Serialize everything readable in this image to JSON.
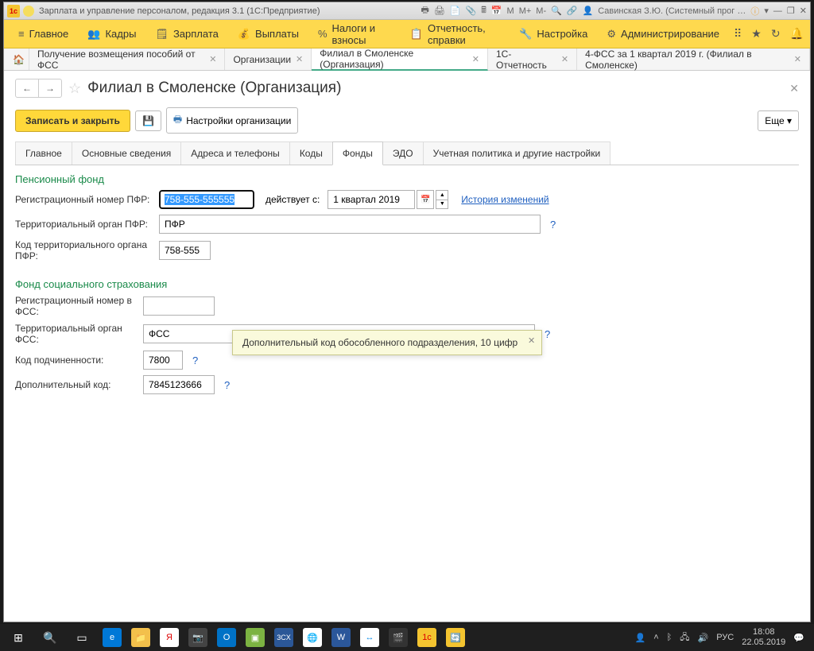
{
  "titlebar": {
    "title": "Зарплата и управление персоналом, редакция 3.1  (1С:Предприятие)",
    "user": "Савинская З.Ю. (Системный прог …",
    "m_icons": [
      "M",
      "M+",
      "M-"
    ]
  },
  "mainmenu": [
    {
      "label": "Главное"
    },
    {
      "label": "Кадры"
    },
    {
      "label": "Зарплата"
    },
    {
      "label": "Выплаты"
    },
    {
      "label": "Налоги и взносы"
    },
    {
      "label": "Отчетность, справки"
    },
    {
      "label": "Настройка"
    },
    {
      "label": "Администрирование"
    }
  ],
  "wtabs": [
    {
      "label": "Получение возмещения пособий от ФСС",
      "active": false
    },
    {
      "label": "Организации",
      "active": false
    },
    {
      "label": "Филиал в Смоленске (Организация)",
      "active": true
    },
    {
      "label": "1С-Отчетность",
      "active": false
    },
    {
      "label": "4-ФСС за 1 квартал 2019 г. (Филиал в Смоленске)",
      "active": false
    }
  ],
  "page": {
    "title": "Филиал в Смоленске (Организация)"
  },
  "toolbar": {
    "save_close": "Записать и закрыть",
    "org_settings": "Настройки организации",
    "more": "Еще"
  },
  "innertabs": [
    {
      "label": "Главное"
    },
    {
      "label": "Основные сведения"
    },
    {
      "label": "Адреса и телефоны"
    },
    {
      "label": "Коды"
    },
    {
      "label": "Фонды",
      "active": true
    },
    {
      "label": "ЭДО"
    },
    {
      "label": "Учетная политика и другие настройки"
    }
  ],
  "pfr": {
    "section": "Пенсионный фонд",
    "reg_label": "Регистрационный номер ПФР:",
    "reg_value": "758-555-555555",
    "valid_from_label": "действует с:",
    "valid_from_value": "1 квартал 2019",
    "history_link": "История изменений",
    "terr_label": "Территориальный орган ПФР:",
    "terr_value": "ПФР",
    "code_label": "Код территориального органа ПФР:",
    "code_value": "758-555"
  },
  "fss": {
    "section": "Фонд социального страхования",
    "reg_label": "Регистрационный номер в ФСС:",
    "reg_value": "",
    "terr_label": "Территориальный орган ФСС:",
    "terr_value": "ФСС",
    "sub_label": "Код подчиненности:",
    "sub_value": "7800",
    "add_label": "Дополнительный код:",
    "add_value": "7845123666"
  },
  "tooltip": {
    "text": "Дополнительный код обособленного подразделения, 10 цифр"
  },
  "taskbar": {
    "clock_time": "18:08",
    "clock_date": "22.05.2019",
    "lang": "РУС"
  }
}
